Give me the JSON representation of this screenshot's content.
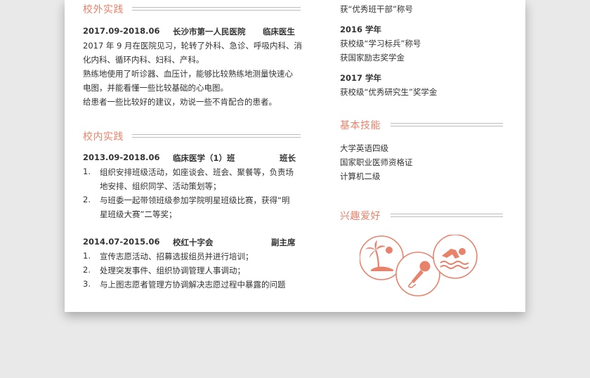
{
  "colors": {
    "accent": "#e9826a",
    "rule": "#bdbdbd",
    "text": "#333333"
  },
  "left": {
    "outside": {
      "title": "校外实践",
      "date": "2017.09-2018.06",
      "org": "长沙市第一人民医院",
      "role": "临床医生",
      "lines": [
        "2017 年 9 月在医院见习，轮转了外科、急诊、呼吸内科、消",
        "化内科、循环内科、妇科、产科。",
        "熟练地使用了听诊器、血压计，能够比较熟练地测量快速心",
        "电图，并能看懂一些比较基础的心电图。",
        "给患者一些比较好的建议，劝说一些不肯配合的患者。"
      ]
    },
    "campus": {
      "title": "校内实践",
      "entry1": {
        "date": "2013.09-2018.06",
        "org": "临床医学（1）班",
        "role": "班长",
        "items": [
          {
            "num": "1.",
            "lines": [
              "组织安排班级活动，如座谈会、班会、聚餐等，负责场",
              "地安排、组织同学、活动策划等；"
            ]
          },
          {
            "num": "2.",
            "lines": [
              "与班委一起带领班级参加学院明星班级比赛，获得“明",
              "星班级大赛”二等奖；"
            ]
          }
        ]
      },
      "entry2": {
        "date": "2014.07-2015.06",
        "org": "校红十字会",
        "role": "副主席",
        "items": [
          {
            "num": "1.",
            "lines": [
              "宣传志愿活动、招募选拔组员并进行培训；"
            ]
          },
          {
            "num": "2.",
            "lines": [
              "处理突发事件、组织协调管理人事调动；"
            ]
          },
          {
            "num": "3.",
            "lines": [
              "与上图志愿者管理方协调解决志愿过程中暴露的问题"
            ]
          }
        ]
      }
    }
  },
  "right": {
    "awards": {
      "top_line": "获“优秀班干部”称号",
      "year1": "2016 学年",
      "year1_items": [
        "获校级“学习标兵”称号",
        "获国家励志奖学金"
      ],
      "year2": "2017 学年",
      "year2_items": [
        "获校级“优秀研究生”奖学金"
      ]
    },
    "skills": {
      "title": "基本技能",
      "items": [
        "大学英语四级",
        "国家职业医师资格证",
        "计算机二级"
      ]
    },
    "hobbies": {
      "title": "兴趣爱好",
      "icons": [
        "beach-palm-icon",
        "microphone-icon",
        "swimming-icon"
      ]
    }
  }
}
